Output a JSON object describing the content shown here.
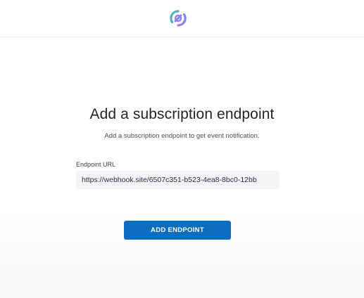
{
  "header": {
    "logo_icon": "circular-arrows-logo-icon",
    "logo_colors": [
      "#3fc7a6",
      "#6a8cf0",
      "#a27be8"
    ]
  },
  "main": {
    "title": "Add a subscription endpoint",
    "subtitle": "Add a subscription endpoint to get event notification.",
    "endpoint_field": {
      "label": "Endpoint URL",
      "value": "https://webhook.site/6507c351-b523-4ea8-8bc0-12bb"
    },
    "add_button_label": "ADD ENDPOINT"
  },
  "colors": {
    "accent": "#0b6dbd",
    "input_background": "#f3f4f6",
    "title_text": "#1f2329"
  }
}
